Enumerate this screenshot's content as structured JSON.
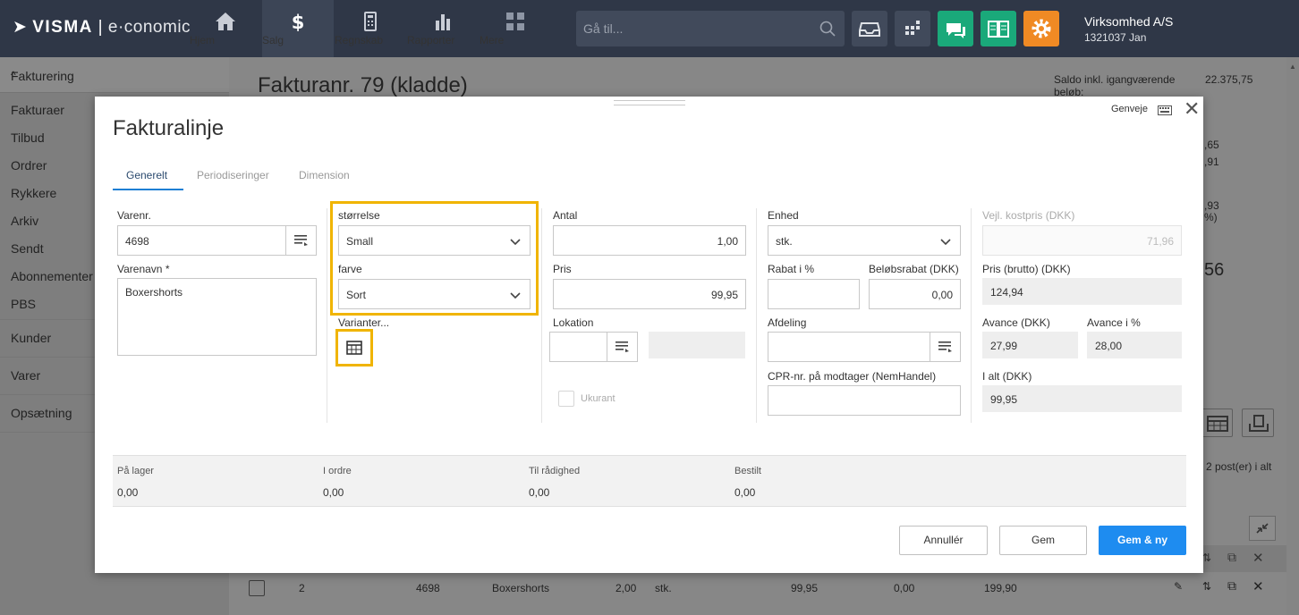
{
  "topbar": {
    "logo_brand": "VISMA",
    "logo_product": "e·conomic",
    "nav": [
      {
        "label": "Hjem"
      },
      {
        "label": "Salg"
      },
      {
        "label": "Regnskab"
      },
      {
        "label": "Rapporter"
      },
      {
        "label": "Mere"
      }
    ],
    "search_placeholder": "Gå til...",
    "company_name": "Virksomhed A/S",
    "company_sub": "1321037 Jan",
    "colors": {
      "bar": "#2f3747",
      "green": "#1aa97a",
      "orange": "#f08a24"
    }
  },
  "sidebar": {
    "section": "Fakturering",
    "sub_items": [
      "Fakturaer",
      "Tilbud",
      "Ordrer",
      "Rykkere",
      "Arkiv",
      "Sendt",
      "Abonnementer",
      "PBS"
    ],
    "sections": [
      "Kunder",
      "Varer",
      "Opsætning"
    ]
  },
  "background": {
    "title": "Fakturanr. 79 (kladde)",
    "saldo_label": "Saldo inkl. igangværende beløb:",
    "saldo_value": "22.375,75",
    "partial_values": [
      ",65",
      ",91",
      ",93",
      "%)"
    ],
    "big_value": "56",
    "posts_text": "2 post(er) i alt",
    "row": {
      "no": "2",
      "varenr": "4698",
      "name": "Boxershorts",
      "qty": "2,00",
      "unit": "stk.",
      "price": "99,95",
      "discount": "0,00",
      "total": "199,90"
    }
  },
  "dialog": {
    "title": "Fakturalinje",
    "genveje": "Genveje",
    "tabs": [
      {
        "label": "Generelt",
        "active": true
      },
      {
        "label": "Periodiseringer",
        "active": false
      },
      {
        "label": "Dimension",
        "active": false
      }
    ],
    "col1": {
      "varenr_label": "Varenr.",
      "varenr_value": "4698",
      "varenavn_label": "Varenavn *",
      "varenavn_value": "Boxershorts"
    },
    "col2": {
      "size_label": "størrelse",
      "size_value": "Small",
      "color_label": "farve",
      "color_value": "Sort",
      "variants_label": "Varianter..."
    },
    "col3": {
      "antal_label": "Antal",
      "antal_value": "1,00",
      "pris_label": "Pris",
      "pris_value": "99,95",
      "lokation_label": "Lokation",
      "ukurant_label": "Ukurant"
    },
    "col4": {
      "enhed_label": "Enhed",
      "enhed_value": "stk.",
      "rabat_label": "Rabat i %",
      "rabat_value": "",
      "belob_label": "Beløbsrabat (DKK)",
      "belob_value": "0,00",
      "afdeling_label": "Afdeling",
      "cpr_label": "CPR-nr. på modtager (NemHandel)"
    },
    "col5": {
      "kost_label": "Vejl. kostpris (DKK)",
      "kost_value": "71,96",
      "brutto_label": "Pris (brutto) (DKK)",
      "brutto_value": "124,94",
      "avance_label": "Avance (DKK)",
      "avance_value": "27,99",
      "avance_pct_label": "Avance i %",
      "avance_pct_value": "28,00",
      "ialt_label": "I alt (DKK)",
      "ialt_value": "99,95"
    },
    "stock": [
      {
        "label": "På lager",
        "value": "0,00"
      },
      {
        "label": "I ordre",
        "value": "0,00"
      },
      {
        "label": "Til rådighed",
        "value": "0,00"
      },
      {
        "label": "Bestilt",
        "value": "0,00"
      }
    ],
    "buttons": {
      "cancel": "Annullér",
      "save": "Gem",
      "save_new": "Gem & ny"
    },
    "highlight_color": "#f0b400"
  }
}
